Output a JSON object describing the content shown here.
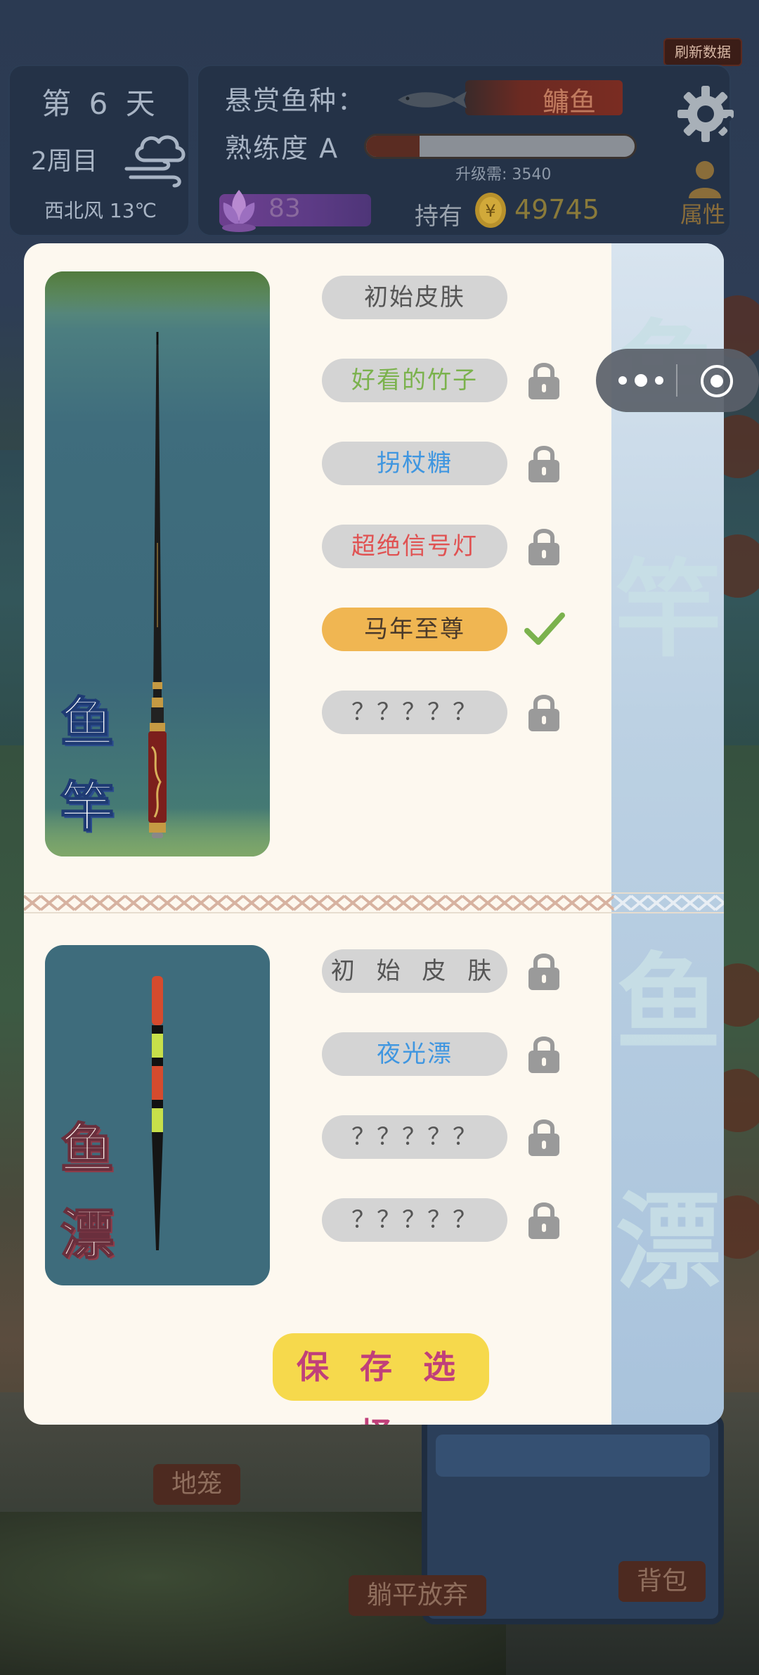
{
  "hud": {
    "refresh_label": "刷新数据",
    "day_label": "第 6 天",
    "round_label": "2周目",
    "weather_icon": "cloud-wind-icon",
    "wind_label": "西北风 13℃",
    "bounty_label": "悬赏鱼种：",
    "bounty_fish": "鳙鱼",
    "skill_label": "熟练度 A",
    "skill_progress": 0.2,
    "upgrade_text": "升级需: 3540",
    "gems": "83",
    "hold_label": "持有",
    "coins": "49745",
    "attr_label": "属性"
  },
  "background_buttons": {
    "cage": "地笼",
    "give_up": "躺平放弃",
    "bag": "背包"
  },
  "modal": {
    "rod_title_1": "鱼",
    "rod_title_2": "竿",
    "float_title_1": "鱼",
    "float_title_2": "漂",
    "rod_options": [
      {
        "label": "初始皮肤",
        "state": "unlocked"
      },
      {
        "label": "好看的竹子",
        "state": "locked"
      },
      {
        "label": "拐杖糖",
        "state": "locked"
      },
      {
        "label": "超绝信号灯",
        "state": "locked"
      },
      {
        "label": "马年至尊",
        "state": "selected"
      },
      {
        "label": "？？？？？",
        "state": "locked"
      }
    ],
    "float_options": [
      {
        "label": "初 始 皮 肤",
        "state": "locked"
      },
      {
        "label": "夜光漂",
        "state": "locked"
      },
      {
        "label": "？？？？？",
        "state": "locked"
      },
      {
        "label": "？？？？？",
        "state": "locked"
      }
    ],
    "save_label": "保 存 选 择",
    "side_glyphs": [
      "鱼",
      "竿",
      "鱼",
      "漂"
    ]
  },
  "colors": {
    "selected": "#f0b652",
    "unlocked_green": "#7bb24d",
    "blue_text": "#3f96e0",
    "red_text": "#e05252",
    "save_button": "#f6d94c",
    "check": "#7bb24d"
  }
}
